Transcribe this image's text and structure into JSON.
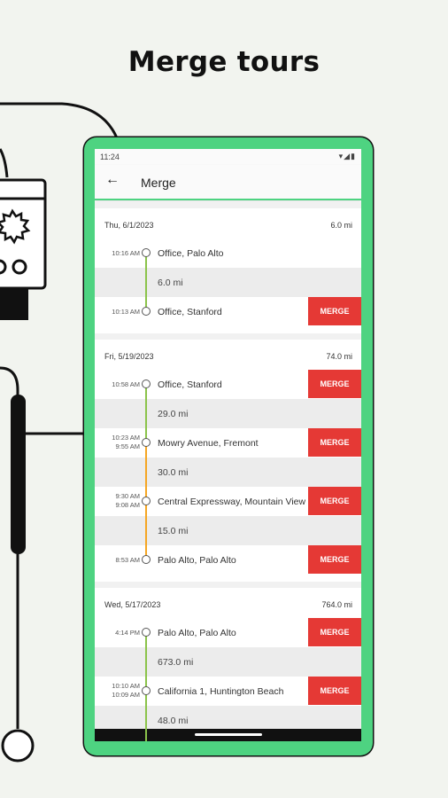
{
  "headline": "Merge tours",
  "status_bar": {
    "time": "11:24",
    "icons": "▾◢▮"
  },
  "app_bar": {
    "back_icon": "arrow-left-icon",
    "title": "Merge"
  },
  "colors": {
    "phone_frame": "#4ed381",
    "merge_button": "#e53935",
    "line_green": "#8bc34a",
    "line_orange": "#f5a623"
  },
  "days": [
    {
      "date": "Thu, 6/1/2023",
      "distance": "6.0 mi",
      "stops": [
        {
          "times": [
            "10:16 AM"
          ],
          "place": "Office, Palo Alto",
          "merge": ""
        },
        {
          "times": [
            "10:13 AM"
          ],
          "place": "Office, Stanford",
          "merge": "MERGE"
        }
      ],
      "segments": [
        {
          "distance": "6.0 mi",
          "color": "green"
        }
      ]
    },
    {
      "date": "Fri, 5/19/2023",
      "distance": "74.0 mi",
      "stops": [
        {
          "times": [
            "10:58 AM"
          ],
          "place": "Office, Stanford",
          "merge": "MERGE"
        },
        {
          "times": [
            "10:23 AM",
            "9:55 AM"
          ],
          "place": "Mowry Avenue, Fremont",
          "merge": "MERGE"
        },
        {
          "times": [
            "9:30 AM",
            "9:08 AM"
          ],
          "place": "Central Expressway, Mountain View",
          "merge": "MERGE"
        },
        {
          "times": [
            "8:53 AM"
          ],
          "place": "Palo Alto, Palo Alto",
          "merge": "MERGE"
        }
      ],
      "segments": [
        {
          "distance": "29.0 mi",
          "color": "green"
        },
        {
          "distance": "30.0 mi",
          "color": "orange"
        },
        {
          "distance": "15.0 mi",
          "color": "orange"
        }
      ]
    },
    {
      "date": "Wed, 5/17/2023",
      "distance": "764.0 mi",
      "stops": [
        {
          "times": [
            "4:14 PM"
          ],
          "place": "Palo Alto, Palo Alto",
          "merge": "MERGE"
        },
        {
          "times": [
            "10:10 AM",
            "10:09 AM"
          ],
          "place": "California 1, Huntington Beach",
          "merge": "MERGE"
        }
      ],
      "segments": [
        {
          "distance": "673.0 mi",
          "color": "green"
        },
        {
          "distance": "48.0 mi",
          "color": "green"
        }
      ]
    }
  ]
}
